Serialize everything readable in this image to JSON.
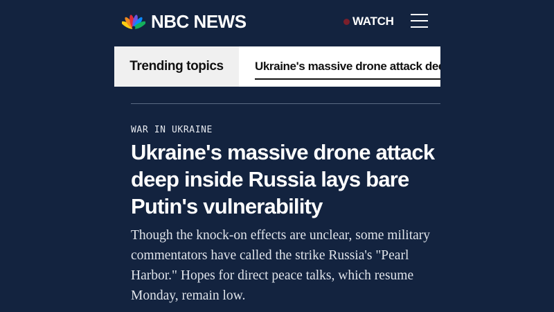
{
  "header": {
    "logo_text": "NBC NEWS",
    "watch_label": "WATCH",
    "live_dot_color": "#7a1f2b",
    "menu_icon": "hamburger-menu-icon"
  },
  "trending": {
    "label": "Trending topics",
    "items": [
      "Ukraine's massive drone attack dee"
    ]
  },
  "article": {
    "kicker": "WAR IN UKRAINE",
    "headline": "Ukraine's massive drone attack deep inside Russia lays bare Putin's vulnerability",
    "dek": "Though the knock-on effects are unclear, some military commentators have called the strike Russia's \"Pearl Harbor.\" Hopes for direct peace talks, which resume Monday, remain low."
  },
  "colors": {
    "background": "#13233f",
    "text": "#ffffff"
  }
}
